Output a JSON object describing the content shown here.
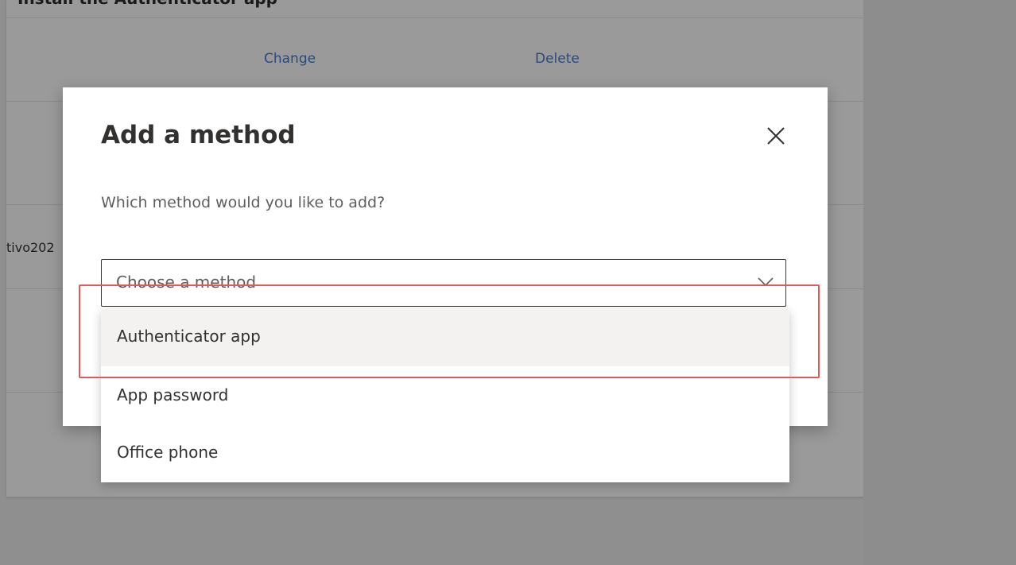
{
  "background": {
    "heading_partial": "Install the Authenticator app",
    "change_link": "Change",
    "delete_link": "Delete",
    "row_fragment": "tivo202"
  },
  "dialog": {
    "title": "Add a method",
    "close_icon": "close-icon",
    "question": "Which method would you like to add?",
    "select": {
      "placeholder": "Choose a method",
      "chevron_icon": "chevron-down-icon"
    },
    "options": [
      {
        "label": "Authenticator app",
        "highlighted": true
      },
      {
        "label": "App password",
        "highlighted": false
      },
      {
        "label": "Office phone",
        "highlighted": false
      }
    ]
  },
  "colors": {
    "overlay": "#8f8f8f",
    "link": "#2b4a7a",
    "annotation": "#e15a5a",
    "option_hover": "#f3f2f1"
  }
}
